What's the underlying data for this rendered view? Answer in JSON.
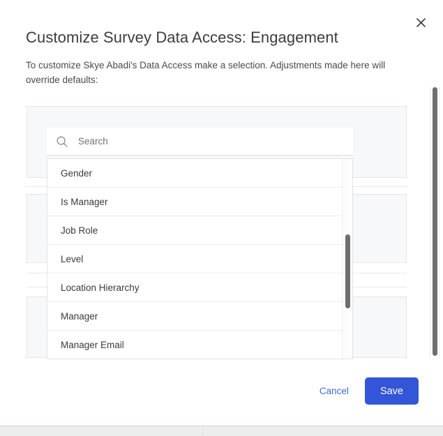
{
  "modal": {
    "title": "Customize Survey Data Access: Engagement",
    "subtitle": "To customize Skye Abadi's Data Access make a selection. Adjustments made here will override defaults:",
    "close_icon": "close-icon"
  },
  "search": {
    "icon": "search-icon",
    "placeholder": "Search",
    "value": ""
  },
  "dropdown": {
    "items": [
      {
        "label": "Gender"
      },
      {
        "label": "Is Manager"
      },
      {
        "label": "Job Role"
      },
      {
        "label": "Level"
      },
      {
        "label": "Location Hierarchy"
      },
      {
        "label": "Manager"
      },
      {
        "label": "Manager Email"
      }
    ]
  },
  "footer": {
    "cancel_label": "Cancel",
    "save_label": "Save"
  },
  "colors": {
    "primary": "#3355d8",
    "link": "#3f6ad8",
    "panel_bg": "#f7f8fa",
    "text": "#3c3c3c",
    "scrollbar": "#6e6e6e"
  }
}
